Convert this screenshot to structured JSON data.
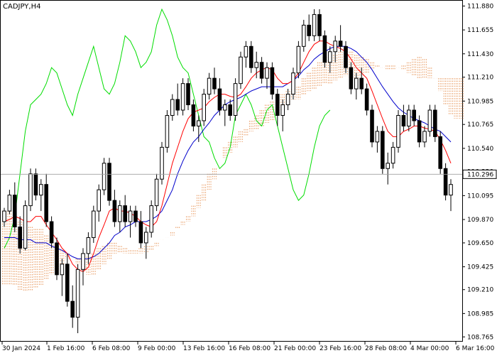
{
  "chart_data": {
    "type": "candlestick",
    "title": "CADJPY,H4",
    "y_ticks": [
      "111.880",
      "111.655",
      "111.430",
      "111.210",
      "110.985",
      "110.765",
      "110.540",
      "110.320",
      "110.095",
      "109.870",
      "109.650",
      "109.425",
      "109.210",
      "108.985",
      "108.765"
    ],
    "ylim": [
      108.72,
      111.93
    ],
    "x_ticks": [
      "30 Jan 2024",
      "1 Feb 16:00",
      "6 Feb 08:00",
      "9 Feb 00:00",
      "13 Feb 16:00",
      "16 Feb 08:00",
      "21 Feb 00:00",
      "23 Feb 16:00",
      "28 Feb 08:00",
      "4 Mar 00:00",
      "6 Mar 16:00"
    ],
    "current_price": "110.296",
    "current_price_value": 110.296,
    "grid": false,
    "colors": {
      "bullish": "#ffffff",
      "bearish": "#000000",
      "tenkan": "#ff0000",
      "kijun": "#0000cc",
      "chikou": "#00dd00",
      "cloud": "#e58a48",
      "price_line": "#a0a0a0"
    },
    "candles": [
      [
        109.85,
        109.98,
        109.8,
        109.95
      ],
      [
        109.95,
        110.15,
        109.92,
        110.1
      ],
      [
        110.1,
        110.22,
        109.75,
        109.8
      ],
      [
        109.8,
        109.9,
        109.55,
        109.6
      ],
      [
        109.6,
        110.05,
        109.58,
        110.0
      ],
      [
        110.0,
        110.35,
        109.95,
        110.3
      ],
      [
        110.3,
        110.35,
        110.05,
        110.1
      ],
      [
        110.1,
        110.25,
        109.95,
        110.2
      ],
      [
        110.2,
        110.3,
        109.8,
        109.85
      ],
      [
        109.85,
        109.9,
        109.6,
        109.65
      ],
      [
        109.65,
        109.7,
        109.3,
        109.35
      ],
      [
        109.35,
        109.5,
        109.15,
        109.45
      ],
      [
        109.45,
        109.55,
        109.05,
        109.1
      ],
      [
        109.1,
        109.25,
        108.85,
        108.95
      ],
      [
        108.95,
        109.45,
        108.8,
        109.4
      ],
      [
        109.4,
        109.6,
        109.25,
        109.55
      ],
      [
        109.55,
        109.75,
        109.45,
        109.7
      ],
      [
        109.7,
        110.0,
        109.65,
        109.95
      ],
      [
        109.95,
        110.2,
        109.85,
        110.15
      ],
      [
        110.15,
        110.45,
        110.1,
        110.4
      ],
      [
        110.4,
        110.45,
        110.0,
        110.05
      ],
      [
        110.05,
        110.15,
        109.8,
        109.85
      ],
      [
        109.85,
        110.05,
        109.75,
        110.0
      ],
      [
        110.0,
        110.1,
        109.8,
        109.85
      ],
      [
        109.85,
        110.0,
        109.7,
        109.95
      ],
      [
        109.95,
        110.0,
        109.8,
        109.85
      ],
      [
        109.85,
        109.95,
        109.6,
        109.65
      ],
      [
        109.65,
        109.8,
        109.5,
        109.75
      ],
      [
        109.75,
        110.05,
        109.7,
        110.0
      ],
      [
        110.0,
        110.3,
        109.95,
        110.25
      ],
      [
        110.25,
        110.6,
        110.2,
        110.55
      ],
      [
        110.55,
        110.9,
        110.5,
        110.85
      ],
      [
        110.85,
        111.05,
        110.8,
        111.0
      ],
      [
        111.0,
        111.15,
        110.85,
        110.9
      ],
      [
        110.9,
        111.2,
        110.85,
        111.15
      ],
      [
        111.15,
        111.2,
        110.9,
        110.95
      ],
      [
        110.95,
        111.0,
        110.7,
        110.75
      ],
      [
        110.75,
        110.85,
        110.6,
        110.8
      ],
      [
        110.8,
        111.1,
        110.75,
        111.05
      ],
      [
        111.05,
        111.25,
        111.0,
        111.2
      ],
      [
        111.2,
        111.3,
        111.05,
        111.1
      ],
      [
        111.1,
        111.2,
        110.85,
        110.9
      ],
      [
        110.9,
        111.0,
        110.75,
        110.95
      ],
      [
        110.95,
        111.0,
        110.8,
        110.85
      ],
      [
        110.85,
        111.2,
        110.8,
        111.15
      ],
      [
        111.15,
        111.45,
        111.1,
        111.4
      ],
      [
        111.4,
        111.55,
        111.3,
        111.5
      ],
      [
        111.5,
        111.55,
        111.25,
        111.3
      ],
      [
        111.3,
        111.45,
        111.2,
        111.35
      ],
      [
        111.35,
        111.4,
        111.15,
        111.2
      ],
      [
        111.2,
        111.35,
        111.1,
        111.3
      ],
      [
        111.3,
        111.35,
        111.0,
        111.05
      ],
      [
        111.05,
        111.1,
        110.75,
        110.85
      ],
      [
        110.85,
        111.0,
        110.7,
        110.95
      ],
      [
        110.95,
        111.1,
        110.9,
        111.05
      ],
      [
        111.05,
        111.3,
        111.0,
        111.25
      ],
      [
        111.25,
        111.55,
        111.2,
        111.5
      ],
      [
        111.5,
        111.75,
        111.45,
        111.7
      ],
      [
        111.7,
        111.8,
        111.55,
        111.6
      ],
      [
        111.6,
        111.85,
        111.55,
        111.8
      ],
      [
        111.8,
        111.85,
        111.55,
        111.6
      ],
      [
        111.6,
        111.65,
        111.3,
        111.35
      ],
      [
        111.35,
        111.5,
        111.25,
        111.45
      ],
      [
        111.45,
        111.6,
        111.35,
        111.55
      ],
      [
        111.55,
        111.7,
        111.45,
        111.5
      ],
      [
        111.5,
        111.55,
        111.25,
        111.3
      ],
      [
        111.3,
        111.35,
        111.05,
        111.1
      ],
      [
        111.1,
        111.25,
        111.0,
        111.2
      ],
      [
        111.2,
        111.3,
        111.05,
        111.1
      ],
      [
        111.1,
        111.15,
        110.85,
        110.9
      ],
      [
        110.9,
        110.95,
        110.55,
        110.6
      ],
      [
        110.6,
        110.75,
        110.5,
        110.7
      ],
      [
        110.7,
        110.75,
        110.3,
        110.35
      ],
      [
        110.35,
        110.5,
        110.2,
        110.4
      ],
      [
        110.4,
        110.6,
        110.35,
        110.55
      ],
      [
        110.55,
        110.9,
        110.5,
        110.85
      ],
      [
        110.85,
        110.95,
        110.7,
        110.75
      ],
      [
        110.75,
        110.95,
        110.7,
        110.9
      ],
      [
        110.9,
        110.95,
        110.75,
        110.8
      ],
      [
        110.8,
        110.85,
        110.55,
        110.6
      ],
      [
        110.6,
        110.75,
        110.55,
        110.7
      ],
      [
        110.7,
        110.95,
        110.65,
        110.9
      ],
      [
        110.9,
        110.95,
        110.6,
        110.65
      ],
      [
        110.65,
        110.7,
        110.3,
        110.35
      ],
      [
        110.35,
        110.4,
        110.05,
        110.1
      ],
      [
        110.1,
        110.25,
        109.95,
        110.2
      ]
    ],
    "tenkan_sen": [
      109.85,
      109.87,
      109.9,
      109.88,
      109.85,
      109.85,
      109.9,
      109.9,
      109.82,
      109.75,
      109.68,
      109.6,
      109.55,
      109.45,
      109.4,
      109.38,
      109.42,
      109.55,
      109.7,
      109.82,
      109.95,
      109.98,
      109.95,
      109.95,
      109.93,
      109.9,
      109.85,
      109.82,
      109.8,
      109.85,
      110.0,
      110.2,
      110.4,
      110.55,
      110.7,
      110.82,
      110.88,
      110.9,
      110.92,
      110.98,
      111.02,
      111.05,
      111.05,
      111.03,
      111.02,
      111.05,
      111.12,
      111.2,
      111.25,
      111.28,
      111.3,
      111.28,
      111.2,
      111.15,
      111.15,
      111.18,
      111.25,
      111.35,
      111.45,
      111.52,
      111.55,
      111.55,
      111.52,
      111.5,
      111.48,
      111.45,
      111.38,
      111.3,
      111.25,
      111.2,
      111.08,
      110.95,
      110.82,
      110.7,
      110.65,
      110.65,
      110.7,
      110.72,
      110.75,
      110.75,
      110.73,
      110.72,
      110.7,
      110.62,
      110.52,
      110.4
    ],
    "kijun_sen": [
      109.7,
      109.7,
      109.7,
      109.68,
      109.68,
      109.68,
      109.65,
      109.65,
      109.65,
      109.62,
      109.6,
      109.58,
      109.55,
      109.52,
      109.5,
      109.5,
      109.5,
      109.52,
      109.55,
      109.6,
      109.65,
      109.72,
      109.75,
      109.8,
      109.82,
      109.85,
      109.85,
      109.85,
      109.87,
      109.9,
      109.95,
      110.05,
      110.15,
      110.3,
      110.42,
      110.52,
      110.6,
      110.65,
      110.72,
      110.78,
      110.85,
      110.9,
      110.95,
      110.98,
      111.0,
      111.02,
      111.05,
      111.08,
      111.1,
      111.12,
      111.12,
      111.12,
      111.12,
      111.12,
      111.15,
      111.18,
      111.22,
      111.28,
      111.32,
      111.38,
      111.42,
      111.45,
      111.48,
      111.5,
      111.5,
      111.5,
      111.48,
      111.45,
      111.4,
      111.35,
      111.28,
      111.2,
      111.12,
      111.05,
      110.98,
      110.92,
      110.88,
      110.85,
      110.82,
      110.8,
      110.78,
      110.75,
      110.72,
      110.7,
      110.65,
      110.6
    ],
    "chikou_span": [
      109.6,
      109.7,
      109.9,
      110.3,
      110.7,
      110.95,
      111.0,
      111.05,
      111.15,
      111.3,
      111.25,
      111.1,
      110.95,
      110.85,
      111.05,
      111.2,
      111.35,
      111.5,
      111.3,
      111.1,
      111.05,
      111.15,
      111.35,
      111.6,
      111.55,
      111.45,
      111.3,
      111.35,
      111.45,
      111.7,
      111.85,
      111.75,
      111.6,
      111.4,
      111.3,
      111.25,
      111.05,
      110.85,
      110.65,
      110.6,
      110.45,
      110.35,
      110.4,
      110.55,
      110.85,
      110.95,
      111.05,
      110.95,
      110.8,
      110.75,
      110.9,
      110.95,
      110.75,
      110.55,
      110.35,
      110.15,
      110.05,
      110.1,
      110.3,
      110.55,
      110.75,
      110.85,
      110.9
    ],
    "senkou_a": [
      109.95,
      109.95,
      109.9,
      109.85,
      109.82,
      109.8,
      109.78,
      109.78,
      109.72,
      109.68,
      109.62,
      109.58,
      109.55,
      109.52,
      109.5,
      109.5,
      109.52,
      109.55,
      109.6,
      109.62,
      109.65,
      109.65,
      109.62,
      109.6,
      109.58,
      109.55,
      109.55,
      109.55,
      109.58,
      109.62,
      109.68,
      109.7,
      109.72,
      109.78,
      109.82,
      109.85,
      109.9,
      109.98,
      110.05,
      110.15,
      110.25,
      110.4,
      110.55,
      110.6,
      110.65,
      110.7,
      110.72,
      110.8,
      110.85,
      110.9,
      110.95,
      110.98,
      111.0,
      111.05,
      111.08,
      111.1,
      111.12,
      111.2,
      111.25,
      111.3,
      111.35,
      111.4,
      111.42,
      111.42,
      111.45,
      111.48,
      111.45,
      111.42,
      111.4,
      111.38,
      111.35,
      111.32,
      111.3,
      111.28,
      111.28,
      111.3,
      111.32,
      111.35,
      111.38,
      111.4,
      111.38,
      111.3,
      111.2,
      111.08,
      110.95,
      110.85,
      110.82,
      110.82
    ],
    "senkou_b": [
      109.25,
      109.25,
      109.25,
      109.2,
      109.2,
      109.2,
      109.22,
      109.25,
      109.3,
      109.35,
      109.4,
      109.45,
      109.5,
      109.52,
      109.45,
      109.38,
      109.35,
      109.35,
      109.4,
      109.45,
      109.5,
      109.55,
      109.55,
      109.55,
      109.55,
      109.58,
      109.6,
      109.62,
      109.62,
      109.65,
      109.68,
      109.7,
      109.75,
      109.8,
      109.85,
      109.9,
      110.0,
      110.1,
      110.2,
      110.3,
      110.35,
      110.4,
      110.45,
      110.5,
      110.55,
      110.6,
      110.65,
      110.7,
      110.72,
      110.75,
      110.78,
      110.8,
      110.85,
      110.9,
      110.95,
      111.0,
      111.0,
      111.05,
      111.08,
      111.1,
      111.12,
      111.15,
      111.15,
      111.18,
      111.2,
      111.22,
      111.2,
      111.2,
      111.22,
      111.25,
      111.28,
      111.3,
      111.3,
      111.32,
      111.32,
      111.3,
      111.28,
      111.25,
      111.22,
      111.2,
      111.2,
      111.2,
      111.2,
      111.2,
      111.2,
      111.2,
      111.2,
      111.2
    ]
  }
}
